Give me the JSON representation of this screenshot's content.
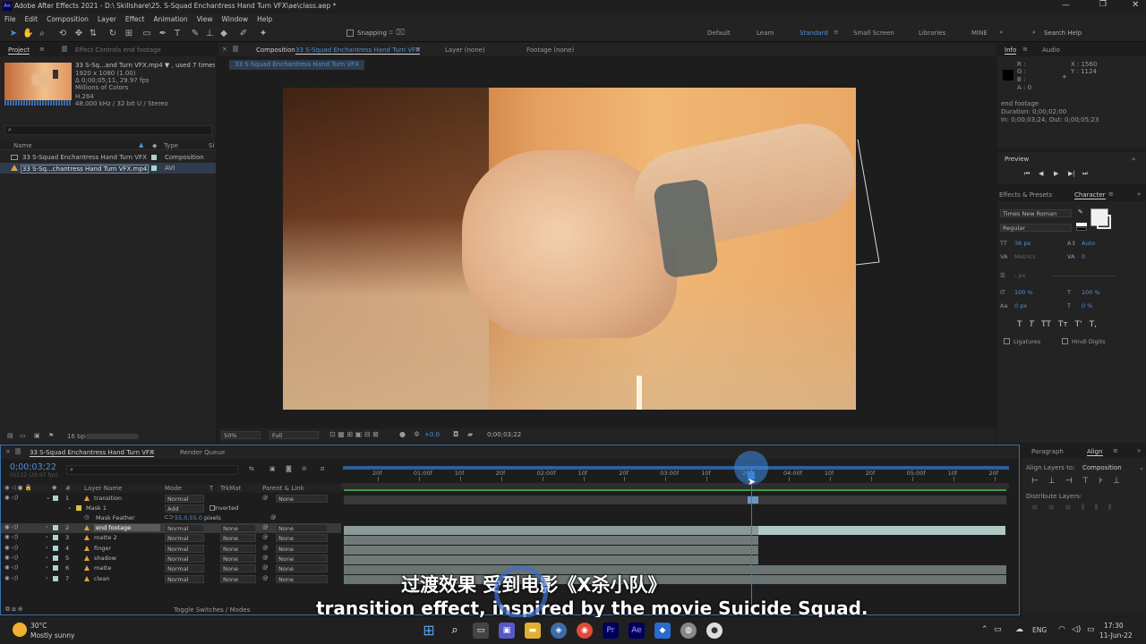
{
  "window": {
    "app_icon": "Ae",
    "title": "Adobe After Effects 2021 - D:\\ Skillshare\\25. S-Squad Enchantress Hand Turn VFX\\ae\\class.aep *"
  },
  "menu": [
    "File",
    "Edit",
    "Composition",
    "Layer",
    "Effect",
    "Animation",
    "View",
    "Window",
    "Help"
  ],
  "toolbar": {
    "snapping": "Snapping",
    "workspaces": [
      "Default",
      "Learn",
      "Standard",
      "Small Screen",
      "Libraries",
      "MINE"
    ],
    "active_workspace": "Standard",
    "search_placeholder": "Search Help"
  },
  "project": {
    "tab_project": "Project",
    "tab_effect_controls": "Effect Controls end footage",
    "file_name": "33 S-Sq...and Turn VFX.mp4 ▼ , used 7 times",
    "info_lines": [
      "1920 x 1080 (1.00)",
      "Δ 0;00;05;11, 29.97 fps",
      "Millions of Colors",
      "H.264",
      "48.000 kHz / 32 bit U / Stereo"
    ],
    "col_name": "Name",
    "col_type": "Type",
    "col_size": "Si",
    "items": [
      {
        "name": "33 S-Squad Enchantress Hand Turn VFX",
        "type": "Composition"
      },
      {
        "name": "33 S-Sq...chantress Hand Turn VFX.mp4",
        "type": "AVI"
      }
    ],
    "bpc": "16 bpc"
  },
  "comp": {
    "tab": "Composition",
    "comp_name": "33 S-Squad Enchantress Hand Turn VFX",
    "tab_layer": "Layer (none)",
    "tab_footage": "Footage (none)",
    "breadcrumb": "33 S-Squad Enchantress Hand Turn VFX",
    "zoom": "50%",
    "resolution": "Full",
    "exposure": "+0.0",
    "timecode": "0;00;03;22"
  },
  "info": {
    "tab_info": "Info",
    "tab_audio": "Audio",
    "r": "R :",
    "g": "G :",
    "b": "B :",
    "a": "A : 0",
    "x": "X : 1560",
    "y": "Y : 1124",
    "layer": "end footage",
    "duration": "Duration: 0;00;02;00",
    "inout": "In: 0;00;03;24, Out: 0;00;05;23"
  },
  "preview": {
    "title": "Preview"
  },
  "character": {
    "tab_effects": "Effects & Presets",
    "tab_character": "Character",
    "font": "Times New Roman",
    "style": "Regular",
    "size": "36 px",
    "leading": "Auto",
    "kerning": "Metrics",
    "tracking": "0",
    "stroke_unit": "- px",
    "vscale": "100 %",
    "hscale": "100 %",
    "baseline": "0 px",
    "tsume": "0 %",
    "ligatures": "Ligatures",
    "hindi": "Hindi Digits",
    "styles": [
      "T",
      "T",
      "TT",
      "Tт",
      "T'",
      "T,"
    ]
  },
  "timeline": {
    "tab": "33 S-Squad Enchantress Hand Turn VFX",
    "render_queue": "Render Queue",
    "timecode": "0;00;03;22",
    "frame": "00112 (29.97 fps)",
    "col_num": "#",
    "col_layer": "Layer Name",
    "col_mode": "Mode",
    "col_t": "T",
    "col_trkmat": "TrkMat",
    "col_parent": "Parent & Link",
    "ruler": [
      "20f",
      "01:00f",
      "10f",
      "20f",
      "02:00f",
      "10f",
      "20f",
      "03:00f",
      "10f",
      "20f",
      "04:00f",
      "10f",
      "20f",
      "05:00f",
      "10f",
      "20f"
    ],
    "layers": [
      {
        "num": "1",
        "name": "transition",
        "mode": "Normal",
        "trkmat": "",
        "parent": "None"
      },
      {
        "num": "2",
        "name": "end footage",
        "mode": "Normal",
        "trkmat": "None",
        "parent": "None"
      },
      {
        "num": "3",
        "name": "matte 2",
        "mode": "Normal",
        "trkmat": "None",
        "parent": "None"
      },
      {
        "num": "4",
        "name": "finger",
        "mode": "Normal",
        "trkmat": "None",
        "parent": "None"
      },
      {
        "num": "5",
        "name": "shadow",
        "mode": "Normal",
        "trkmat": "None",
        "parent": "None"
      },
      {
        "num": "6",
        "name": "matte",
        "mode": "Normal",
        "trkmat": "None",
        "parent": "None"
      },
      {
        "num": "7",
        "name": "clean",
        "mode": "Normal",
        "trkmat": "None",
        "parent": "None"
      }
    ],
    "mask": "Mask 1",
    "mask_mode": "Add",
    "mask_inverted": "Inverted",
    "mask_feather": "Mask Feather",
    "feather_value": "55.0,55.0",
    "feather_unit": "pixels",
    "toggle": "Toggle Switches / Modes"
  },
  "align": {
    "tab_paragraph": "Paragraph",
    "tab_align": "Align",
    "align_to_label": "Align Layers to:",
    "align_to": "Composition",
    "distribute": "Distribute Layers:"
  },
  "subtitles": {
    "cn": "过渡效果 受到电影《X杀小队》",
    "en": "transition effect, inspired by the movie Suicide Squad."
  },
  "taskbar": {
    "temp": "30°C",
    "weather": "Mostly sunny",
    "lang": "ENG",
    "time": "17:30",
    "date": "11-Jun-22"
  },
  "colors": {
    "accent": "#4f90d8",
    "timeline_bar": "#8a9a98",
    "comp_label": "#a8d4d0",
    "layer_label": "#d8a070"
  }
}
